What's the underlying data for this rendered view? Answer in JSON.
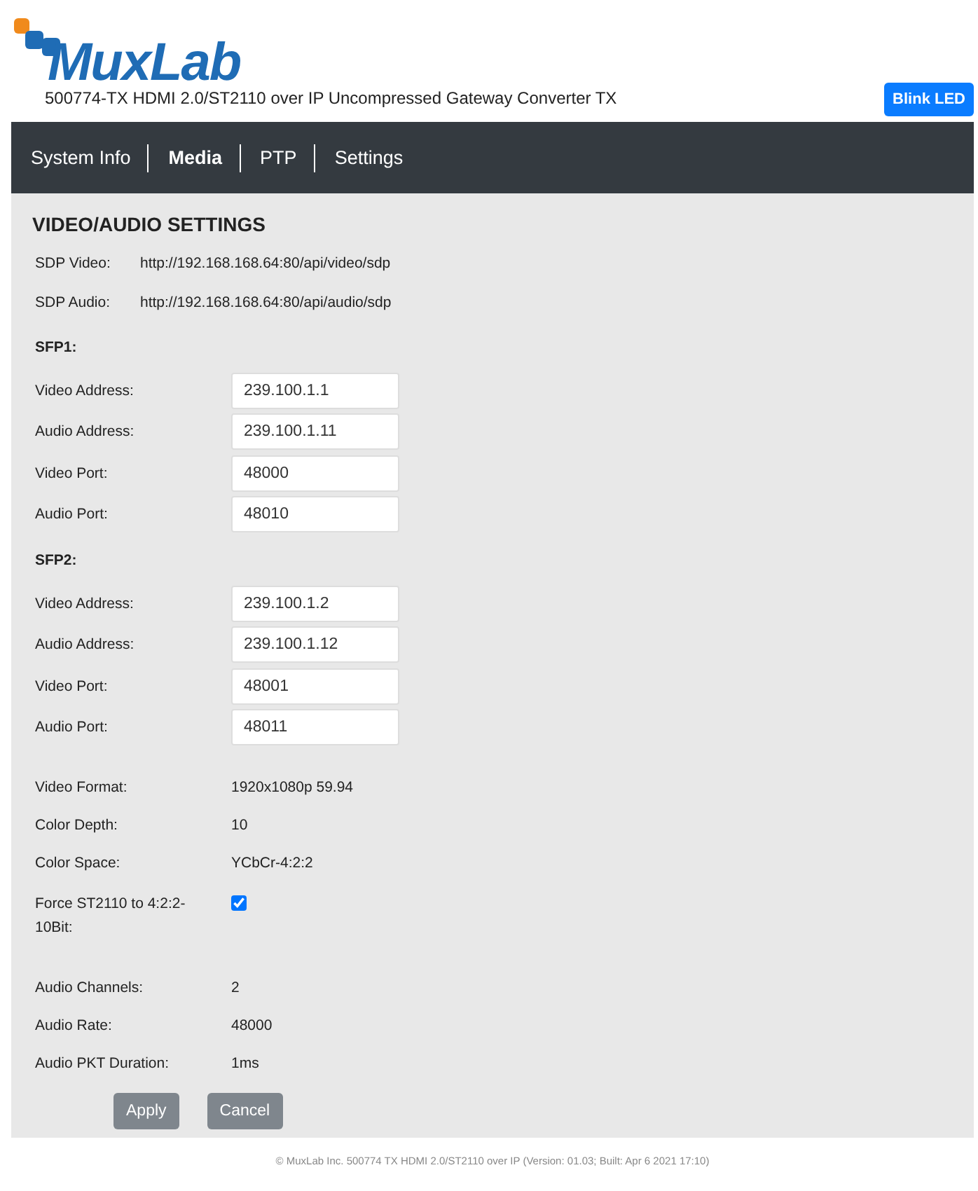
{
  "header": {
    "logo": "MuxLab",
    "product": "500774-TX HDMI 2.0/ST2110 over IP Uncompressed Gateway Converter TX",
    "blink_button": "Blink LED"
  },
  "nav": [
    {
      "label": "System Info",
      "selected": false
    },
    {
      "label": "Media",
      "selected": true
    },
    {
      "label": "PTP",
      "selected": false
    },
    {
      "label": "Settings",
      "selected": false
    }
  ],
  "title": "VIDEO/AUDIO SETTINGS",
  "sdp": [
    {
      "label": "SDP Video:",
      "value": "http://192.168.168.64:80/api/video/sdp"
    },
    {
      "label": "SDP Audio:",
      "value": "http://192.168.168.64:80/api/audio/sdp"
    }
  ],
  "sfps": [
    {
      "heading": "SFP1:",
      "fields": [
        {
          "label": "Video Address:",
          "value": "239.100.1.1"
        },
        {
          "label": "Audio Address:",
          "value": "239.100.1.11"
        },
        {
          "label": "Video Port:",
          "value": "48000"
        },
        {
          "label": "Audio Port:",
          "value": "48010"
        }
      ]
    },
    {
      "heading": "SFP2:",
      "fields": [
        {
          "label": "Video Address:",
          "value": "239.100.1.2"
        },
        {
          "label": "Audio Address:",
          "value": "239.100.1.12"
        },
        {
          "label": "Video Port:",
          "value": "48001"
        },
        {
          "label": "Audio Port:",
          "value": "48011"
        }
      ]
    }
  ],
  "info": [
    {
      "kind": "text",
      "label": "Video Format:",
      "value": "1920x1080p 59.94"
    },
    {
      "kind": "text",
      "label": "Color Depth:",
      "value": "10"
    },
    {
      "kind": "text",
      "label": "Color Space:",
      "value": "YCbCr-4:2:2"
    },
    {
      "kind": "checkbox",
      "label": "Force ST2110 to 4:2:2-10Bit:",
      "checked": true
    },
    {
      "kind": "text",
      "label": "Audio Channels:",
      "value": "2"
    },
    {
      "kind": "text",
      "label": "Audio Rate:",
      "value": "48000"
    },
    {
      "kind": "text",
      "label": "Audio PKT Duration:",
      "value": "1ms"
    }
  ],
  "buttons": [
    "Apply",
    "Cancel"
  ],
  "footer": "© MuxLab Inc. 500774 TX HDMI 2.0/ST2110 over IP (Version: 01.03; Built: Apr 6 2021 17:10)"
}
